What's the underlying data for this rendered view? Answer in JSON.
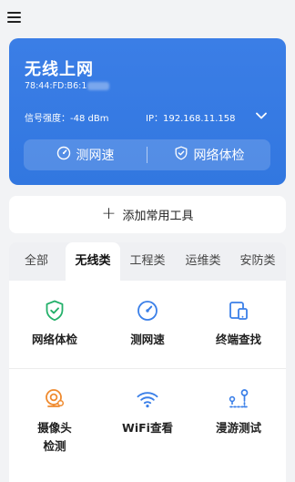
{
  "wifi": {
    "title": "无线上网",
    "mac": "78:44:FD:B6:1",
    "signal": "信号强度：-48 dBm",
    "ip": "IP：192.168.11.158",
    "speed_label": "测网速",
    "check_label": "网络体检"
  },
  "add_tool": {
    "label": "添加常用工具"
  },
  "tabs": [
    {
      "label": "全部"
    },
    {
      "label": "无线类",
      "active": true
    },
    {
      "label": "工程类"
    },
    {
      "label": "运维类"
    },
    {
      "label": "安防类"
    }
  ],
  "tools": [
    {
      "label": "网络体检",
      "icon": "shield-check-icon",
      "color": "#23b06a"
    },
    {
      "label": "测网速",
      "icon": "speedometer-icon",
      "color": "#3a7fe8"
    },
    {
      "label": "终端查找",
      "icon": "devices-icon",
      "color": "#3a7fe8"
    },
    {
      "label": "摄像头检测",
      "icon": "camera-scan-icon",
      "color": "#ef8a2e"
    },
    {
      "label": "WiFi查看",
      "icon": "wifi-icon",
      "color": "#3a7fe8"
    },
    {
      "label": "漫游测试",
      "icon": "roaming-icon",
      "color": "#3a7fe8"
    }
  ]
}
